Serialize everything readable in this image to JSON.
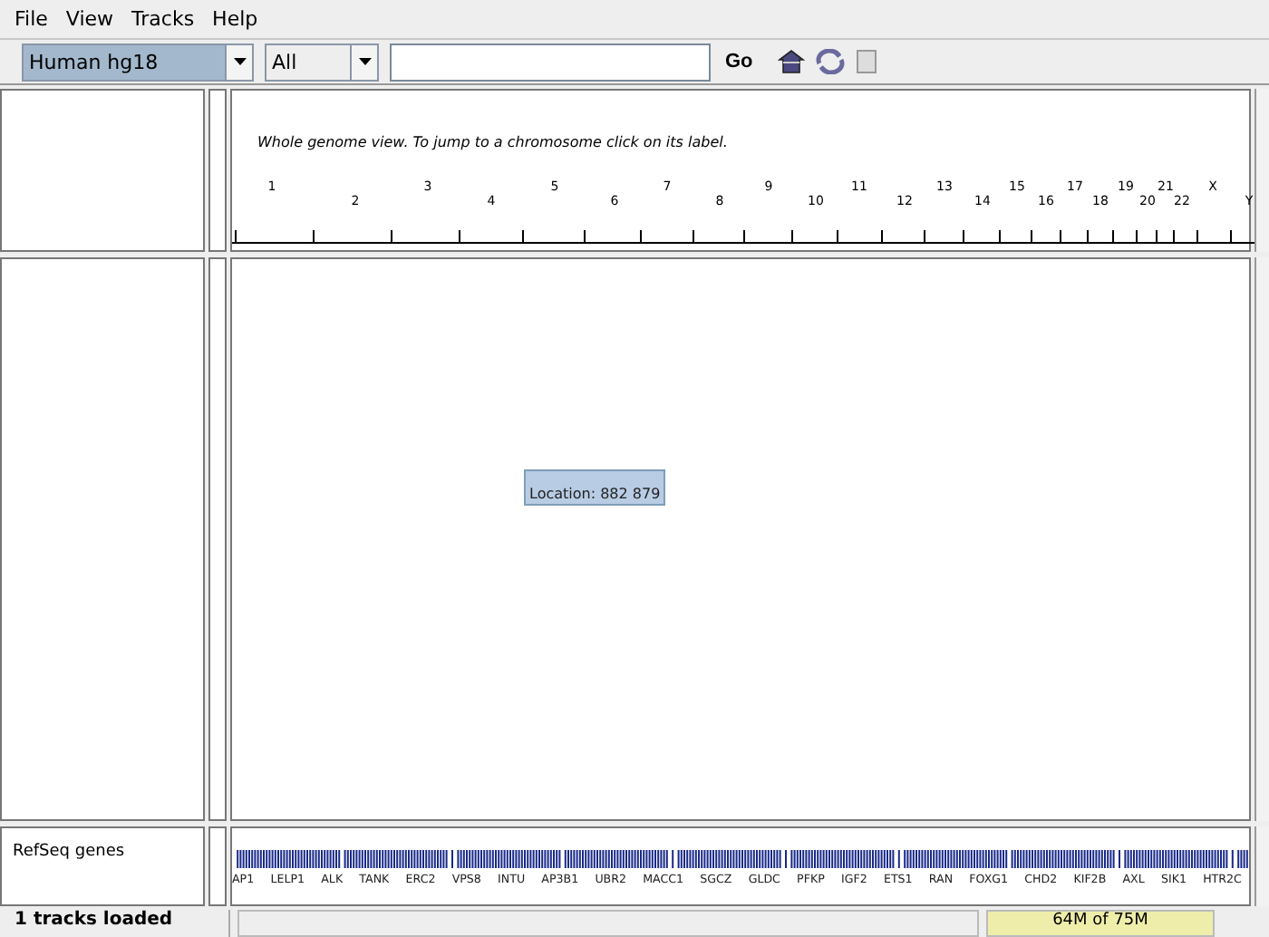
{
  "menu": [
    "File",
    "View",
    "Tracks",
    "Help"
  ],
  "toolbar": {
    "genome": "Human hg18",
    "chromosome": "All",
    "go": "Go"
  },
  "header": {
    "note": "Whole genome view.  To jump to a chromosome click on its label.",
    "chromosomes": [
      "1",
      "2",
      "3",
      "4",
      "5",
      "6",
      "7",
      "8",
      "9",
      "10",
      "11",
      "12",
      "13",
      "14",
      "15",
      "16",
      "17",
      "18",
      "19",
      "20",
      "21",
      "22",
      "X",
      "Y"
    ]
  },
  "tooltip": "Location: 882 879",
  "feature_track": {
    "name": "RefSeq genes",
    "genes": [
      "AP1",
      "LELP1",
      "ALK",
      "TANK",
      "ERC2",
      "VPS8",
      "INTU",
      "AP3B1",
      "UBR2",
      "MACC1",
      "SGCZ",
      "GLDC",
      "PFKP",
      "IGF2",
      "ETS1",
      "RAN",
      "FOXG1",
      "CHD2",
      "KIF2B",
      "AXL",
      "SIK1",
      "HTR2C"
    ]
  },
  "status": {
    "message": "1 tracks loaded",
    "memory": "64M of 75M"
  }
}
